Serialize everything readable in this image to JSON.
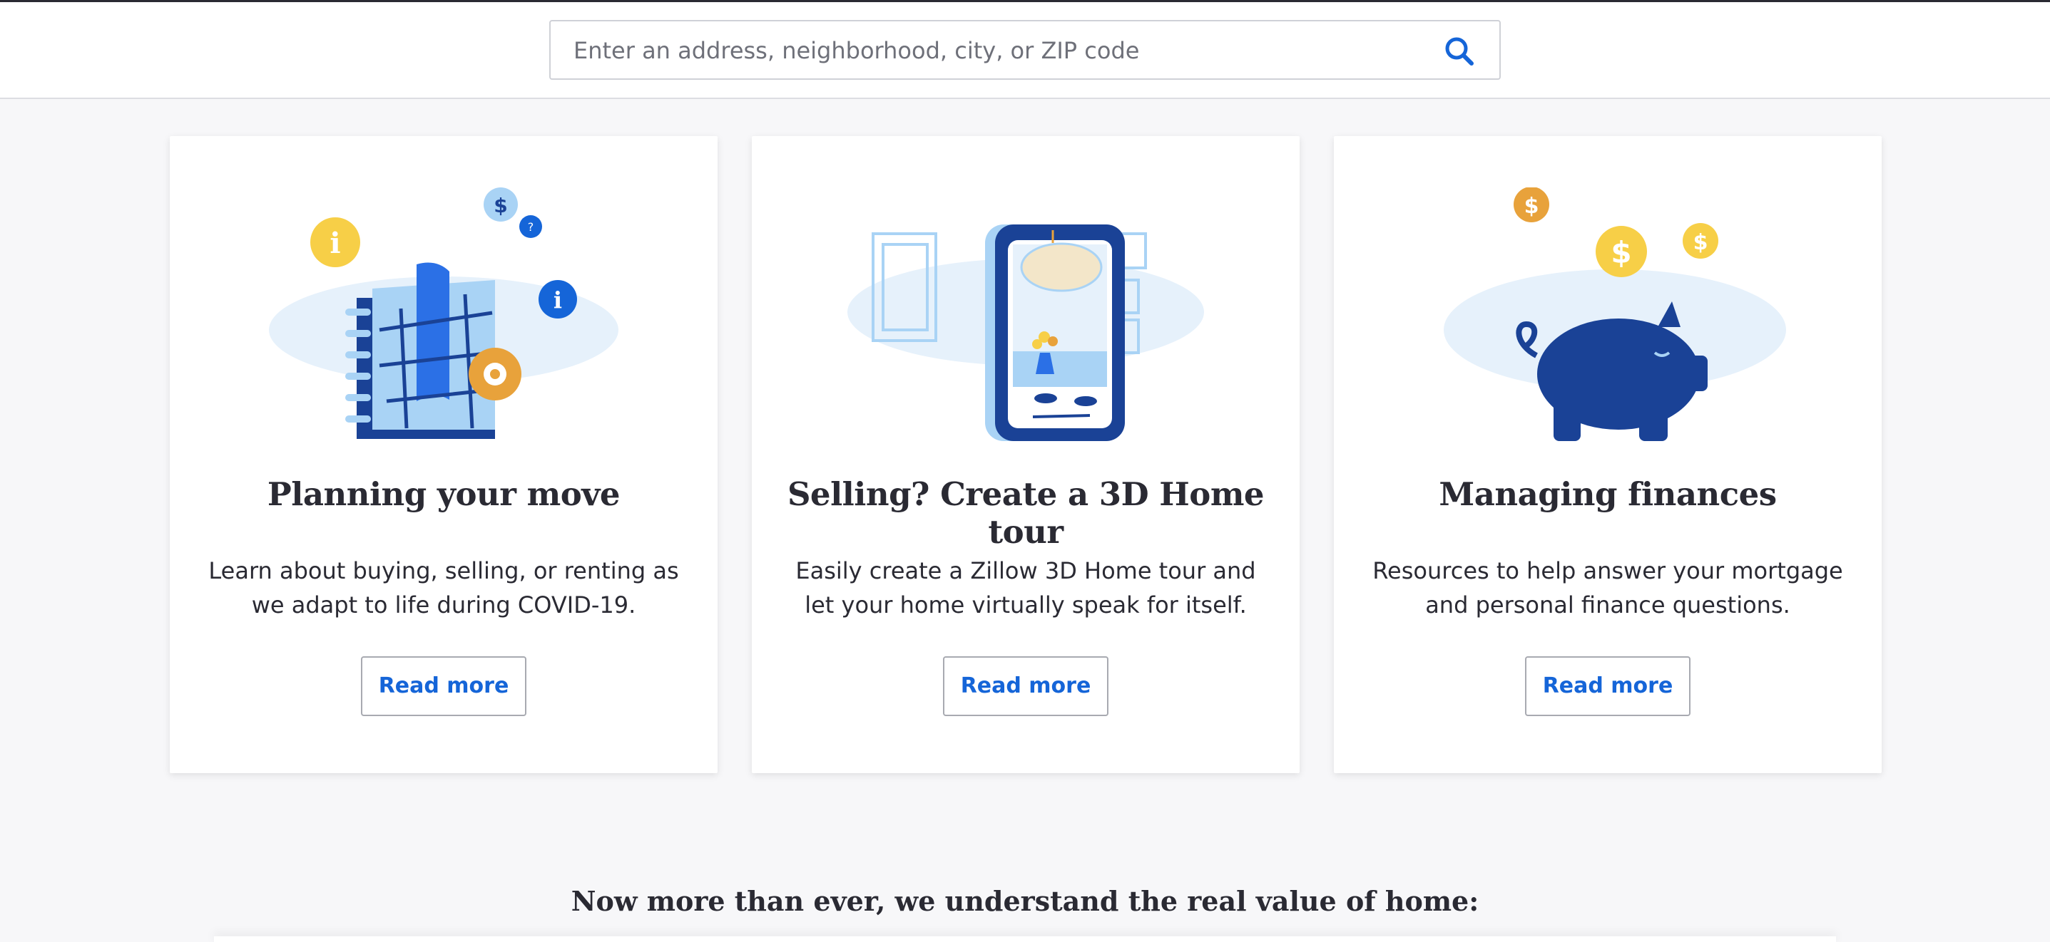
{
  "search": {
    "placeholder": "Enter an address, neighborhood, city, or ZIP code",
    "value": ""
  },
  "cards": [
    {
      "title": "Planning your move",
      "description": "Learn about buying, selling, or renting as we adapt to life during COVID-19.",
      "button": "Read more",
      "illustration": "notebook-icon"
    },
    {
      "title": "Selling? Create a 3D Home tour",
      "description": "Easily create a Zillow 3D Home tour and let your home virtually speak for itself.",
      "button": "Read more",
      "illustration": "phone-home-tour-icon"
    },
    {
      "title": "Managing finances",
      "description": "Resources to help answer your mortgage and personal finance questions.",
      "button": "Read more",
      "illustration": "piggy-bank-icon"
    }
  ],
  "bottom_heading": "Now more than ever, we understand the real value of home:",
  "colors": {
    "link_blue": "#1565d8",
    "navy": "#1a4296",
    "light_blue": "#a9d3f5",
    "gold": "#e8a23b",
    "yellow": "#f7cf47",
    "text": "#2a2a33"
  }
}
